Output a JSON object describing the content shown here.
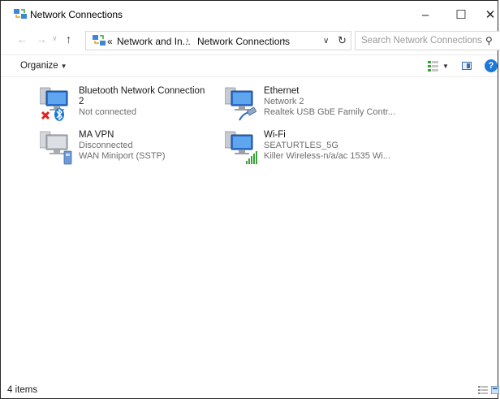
{
  "window": {
    "title": "Network Connections",
    "controls": {
      "minimize": "–",
      "maximize": "☐",
      "close": "✕"
    }
  },
  "address": {
    "overflow": "«",
    "segments": [
      "Network and In...",
      "Network Connections"
    ],
    "separator": "›",
    "search_placeholder": "Search Network Connections"
  },
  "command_bar": {
    "organize_label": "Organize",
    "help_label": "?"
  },
  "connections": [
    {
      "name_line1": "Bluetooth Network Connection",
      "name_line2": "2",
      "status": "Not connected",
      "device": "",
      "icon": "bluetooth-network-icon"
    },
    {
      "name_line1": "Ethernet",
      "name_line2": "",
      "status": "Network 2",
      "device": "Realtek USB GbE Family Contr...",
      "icon": "ethernet-network-icon"
    },
    {
      "name_line1": "MA VPN",
      "name_line2": "",
      "status": "Disconnected",
      "device": "WAN Miniport (SSTP)",
      "icon": "vpn-network-icon"
    },
    {
      "name_line1": "Wi-Fi",
      "name_line2": "",
      "status": "SEATURTLES_5G",
      "device": "Killer Wireless-n/a/ac 1535 Wi...",
      "icon": "wifi-network-icon"
    }
  ],
  "status_bar": {
    "item_count": "4 items"
  },
  "colors": {
    "accent": "#1e78d6",
    "error": "#e02020",
    "signal": "#3aa33a"
  }
}
